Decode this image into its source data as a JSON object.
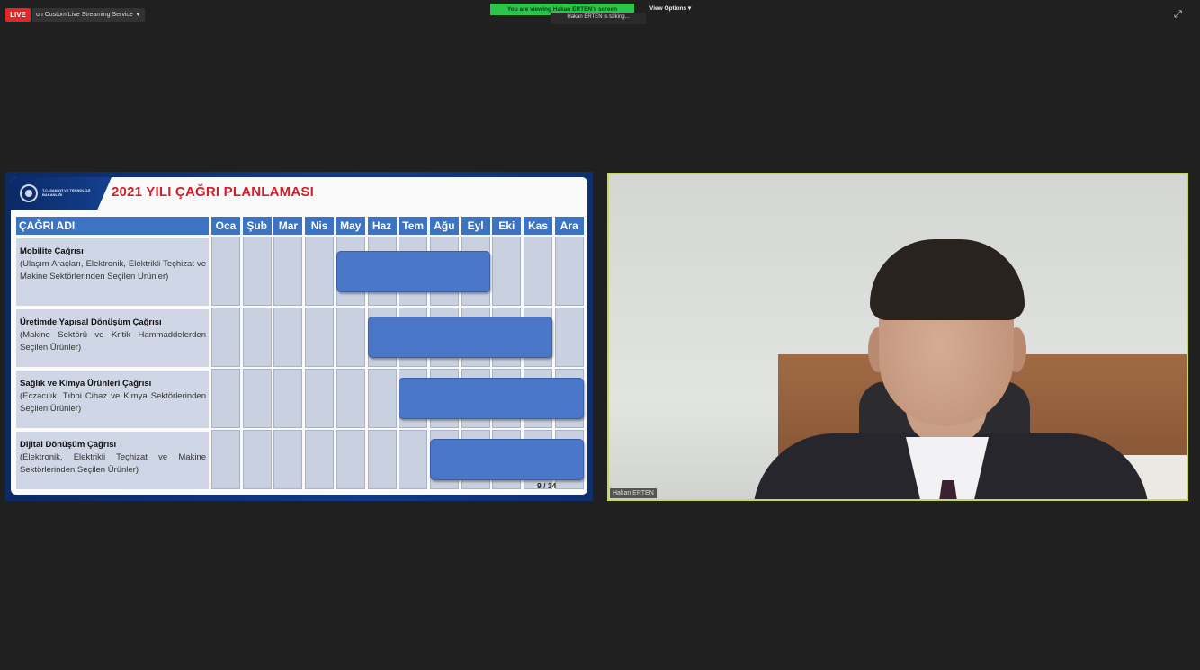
{
  "topbar": {
    "live_badge": "LIVE",
    "live_source": "on Custom Live Streaming Service",
    "viewing_banner": "You are viewing Hakan ERTEN's screen",
    "talking_label": "Hakan ERTEN is talking...",
    "view_options": "View Options"
  },
  "slide": {
    "ministry_name": "T.C. SANAYİ VE TEKNOLOJİ BAKANLIĞI",
    "title": "2021 YILI ÇAĞRI PLANLAMASI",
    "name_header": "ÇAĞRI ADI",
    "months": [
      "Oca",
      "Şub",
      "Mar",
      "Nis",
      "May",
      "Haz",
      "Tem",
      "Ağu",
      "Eyl",
      "Eki",
      "Kas",
      "Ara"
    ],
    "rows": [
      {
        "title": "Mobilite Çağrısı",
        "desc": "(Ulaşım Araçları, Elektronik, Elektrikli Teçhizat ve Makine Sektörlerinden Seçilen Ürünler)",
        "start_month": "May",
        "end_month": "Eyl"
      },
      {
        "title": "Üretimde Yapısal Dönüşüm Çağrısı",
        "desc": "(Makine Sektörü ve Kritik Hammaddelerden Seçilen Ürünler)",
        "start_month": "Haz",
        "end_month": "Kas"
      },
      {
        "title": "Sağlık ve Kimya Ürünleri Çağrısı",
        "desc": "(Eczacılık, Tıbbi Cihaz ve Kimya Sektörlerinden Seçilen Ürünler)",
        "start_month": "Tem",
        "end_month": "Ara"
      },
      {
        "title": "Dijital Dönüşüm Çağrısı",
        "desc": "(Elektronik, Elektrikli Teçhizat ve Makine Sektörlerinden Seçilen Ürünler)",
        "start_month": "Ağu",
        "end_month": "Ara"
      }
    ],
    "page_number": "9 / 34",
    "colors": {
      "header": "#3c73c3",
      "bar": "#4a77c8",
      "title": "#d1202c",
      "tile_border": "#c7d85a"
    }
  },
  "video": {
    "participant_name": "Hakan ERTEN"
  },
  "icons": {
    "expand": "expand-icon",
    "caret": "chevron-down-icon",
    "emblem": "ministry-emblem-icon"
  }
}
